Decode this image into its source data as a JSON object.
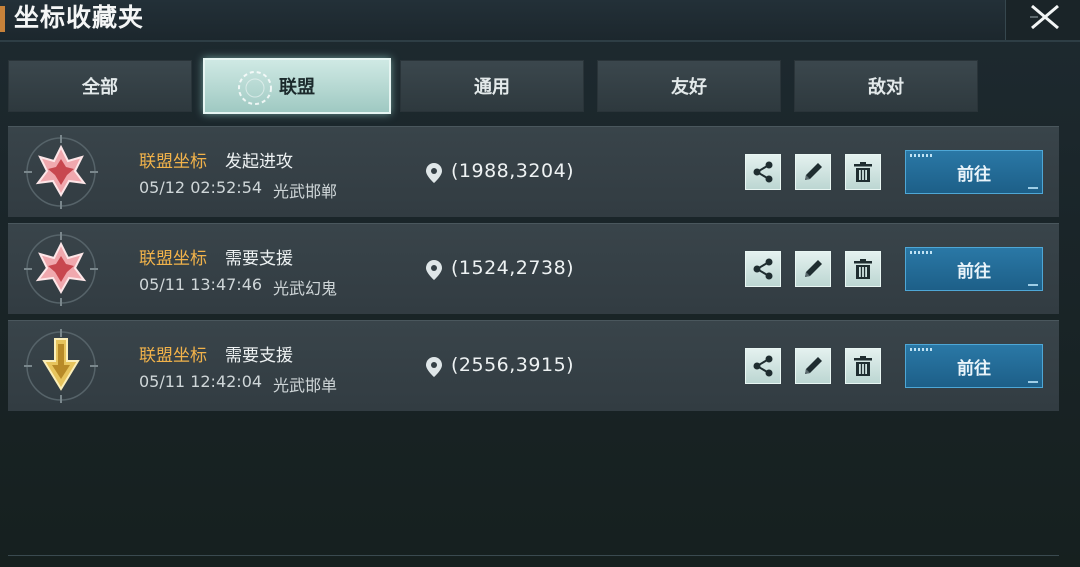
{
  "window": {
    "title": "坐标收藏夹"
  },
  "tabs": [
    {
      "label": "全部",
      "active": false
    },
    {
      "label": "联盟",
      "active": true
    },
    {
      "label": "通用",
      "active": false
    },
    {
      "label": "友好",
      "active": false
    },
    {
      "label": "敌对",
      "active": false
    }
  ],
  "rows": [
    {
      "type": "联盟坐标",
      "desc": "发起进攻",
      "time": "05/12 02:52:54",
      "place": "光武邯郸",
      "coords": "(1988,3204)",
      "icon": "attack-emblem-icon",
      "go_label": "前往"
    },
    {
      "type": "联盟坐标",
      "desc": "需要支援",
      "time": "05/11 13:47:46",
      "place": "光武幻鬼",
      "coords": "(1524,2738)",
      "icon": "attack-emblem-icon",
      "go_label": "前往"
    },
    {
      "type": "联盟坐标",
      "desc": "需要支援",
      "time": "05/11 12:42:04",
      "place": "光武邯单",
      "coords": "(2556,3915)",
      "icon": "gather-arrow-emblem-icon",
      "go_label": "前往"
    }
  ],
  "colors": {
    "accent_orange": "#f1b24a",
    "go_button": "#2a78a6",
    "tab_active": "#cfe9e4"
  }
}
